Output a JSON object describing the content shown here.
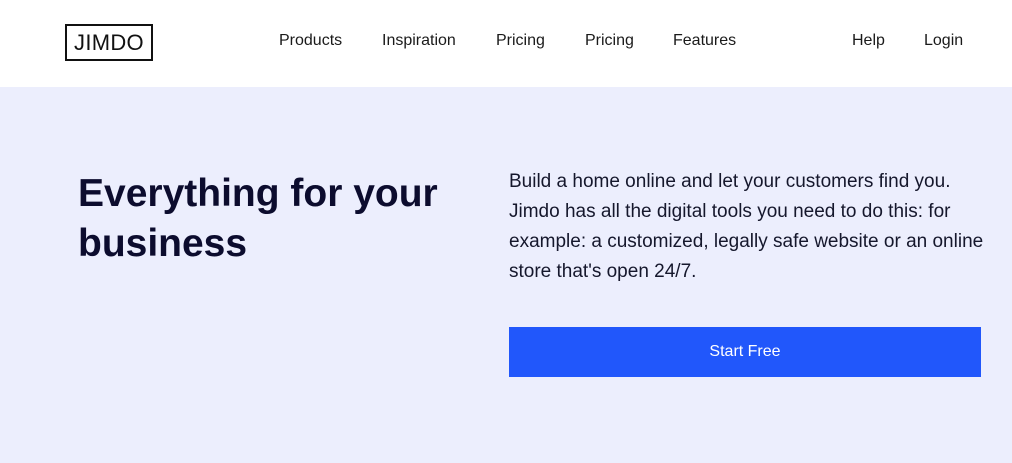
{
  "header": {
    "logo_text": "JIMDO",
    "nav": {
      "products": "Products",
      "inspiration": "Inspiration",
      "pricing_1": "Pricing",
      "pricing_2": "Pricing",
      "features": "Features",
      "help": "Help",
      "login": "Login"
    }
  },
  "hero": {
    "headline": "Everything for your business",
    "description": "Build a home online and let your customers find you. Jimdo has all the digital tools you need to do this: for example: a customized, legally safe website or an online store that's open 24/7.",
    "cta_label": "Start Free"
  },
  "colors": {
    "header_bg": "#ffffff",
    "page_bg": "#eceefd",
    "accent": "#2157fb",
    "headline": "#0c0c2e"
  }
}
